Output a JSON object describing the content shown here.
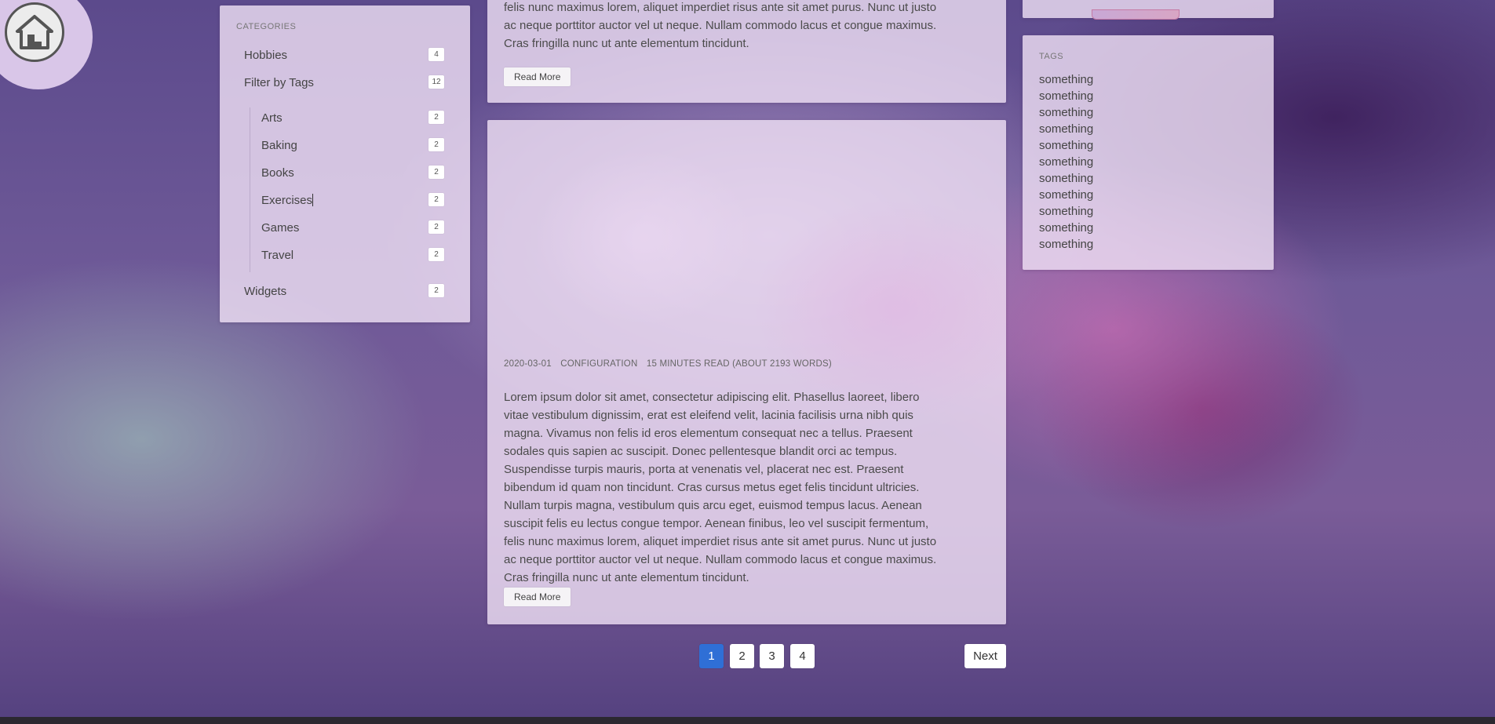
{
  "categories": {
    "heading": "CATEGORIES",
    "items": [
      {
        "label": "Hobbies",
        "count": "4"
      },
      {
        "label": "Filter by Tags",
        "count": "12"
      },
      {
        "label": "Widgets",
        "count": "2"
      }
    ],
    "subitems": [
      {
        "label": "Arts",
        "count": "2"
      },
      {
        "label": "Baking",
        "count": "2"
      },
      {
        "label": "Books",
        "count": "2"
      },
      {
        "label": "Exercises",
        "count": "2"
      },
      {
        "label": "Games",
        "count": "2"
      },
      {
        "label": "Travel",
        "count": "2"
      }
    ]
  },
  "post_top": {
    "text": "felis nunc maximus lorem, aliquet imperdiet risus ante sit amet purus. Nunc ut justo\nac neque porttitor auctor vel ut neque. Nullam commodo lacus et congue maximus.\nCras fringilla nunc ut ante elementum tincidunt.",
    "read_more": "Read More"
  },
  "post_main": {
    "date": "2020-03-01",
    "category": "CONFIGURATION",
    "read_time": "15 MINUTES READ (ABOUT 2193 WORDS)",
    "text": "Lorem ipsum dolor sit amet, consectetur adipiscing elit. Phasellus laoreet, libero\nvitae vestibulum dignissim, erat est eleifend velit, lacinia facilisis urna nibh quis\nmagna. Vivamus non felis id eros elementum consequat nec a tellus. Praesent\nsodales quis sapien ac suscipit. Donec pellentesque blandit orci ac tempus.\nSuspendisse turpis mauris, porta at venenatis vel, placerat nec est. Praesent\nbibendum id quam non tincidunt. Cras cursus metus eget felis tincidunt ultricies.\nNullam turpis magna, vestibulum quis arcu eget, euismod tempus lacus. Aenean\nsuscipit felis eu lectus congue tempor. Aenean finibus, leo vel suscipit fermentum,\nfelis nunc maximus lorem, aliquet imperdiet risus ante sit amet purus. Nunc ut justo\nac neque porttitor auctor vel ut neque. Nullam commodo lacus et congue maximus.\nCras fringilla nunc ut ante elementum tincidunt.",
    "read_more": "Read More"
  },
  "tags": {
    "heading": "TAGS",
    "items": [
      "something",
      "something",
      "something",
      "something",
      "something",
      "something",
      "something",
      "something",
      "something",
      "something",
      "something"
    ]
  },
  "pagination": {
    "pages": [
      "1",
      "2",
      "3",
      "4"
    ],
    "active": "1",
    "next": "Next"
  },
  "colors": {
    "accent": "#2f6fd6"
  }
}
